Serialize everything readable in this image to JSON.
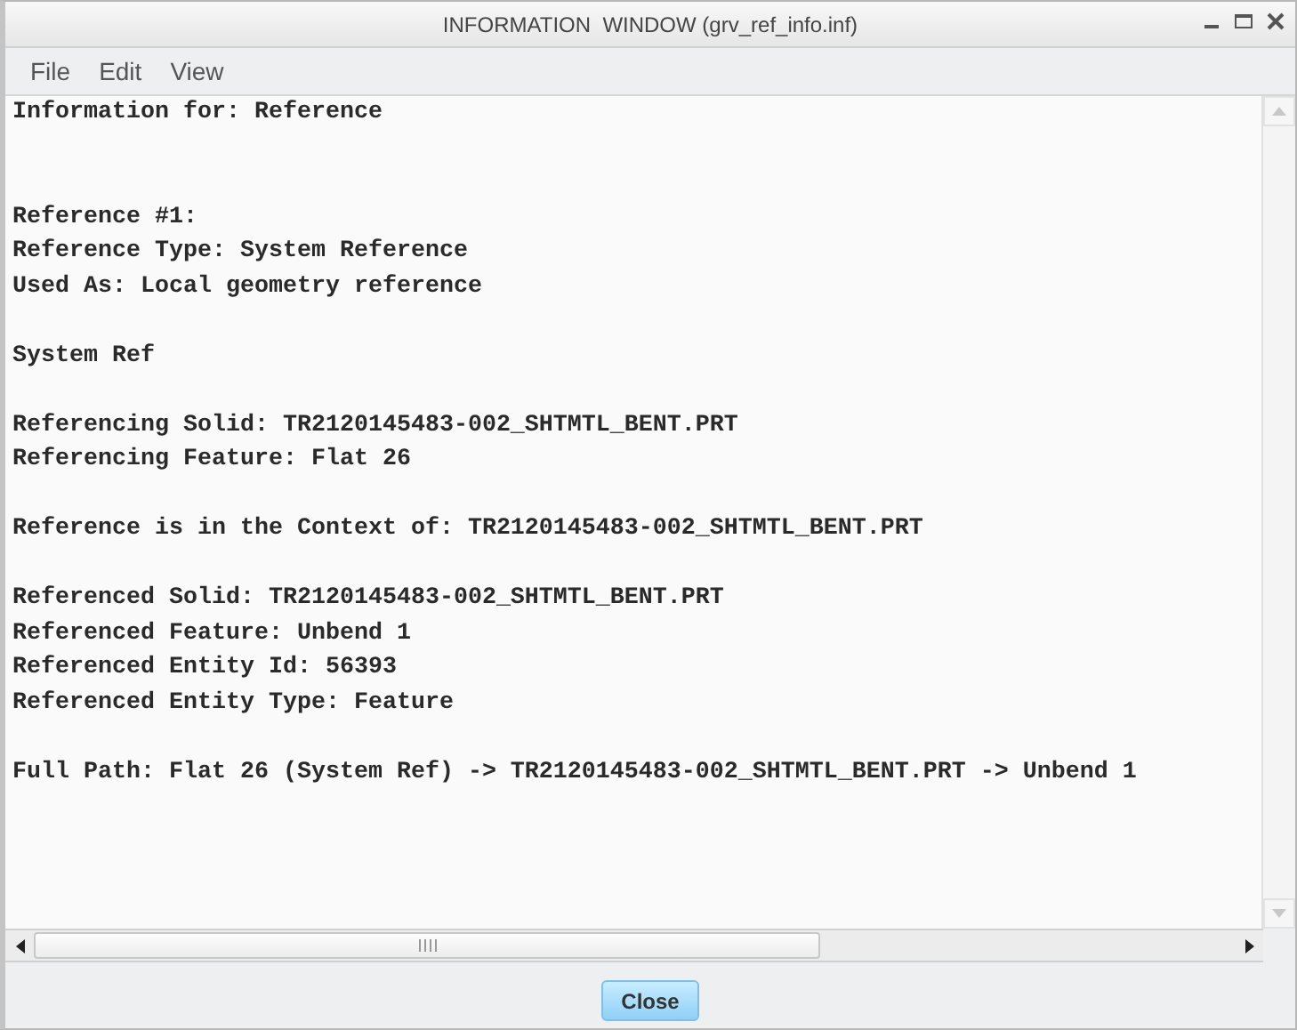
{
  "window": {
    "title": "INFORMATION  WINDOW (grv_ref_info.inf)"
  },
  "menu": [
    {
      "label": "File"
    },
    {
      "label": "Edit"
    },
    {
      "label": "View"
    }
  ],
  "content": [
    {
      "kind": "heading",
      "lines": [
        "Information for: Reference"
      ]
    },
    {
      "kind": "block",
      "lines": [
        "Reference #1:",
        "Reference Type: System Reference",
        "Used As: Local geometry reference"
      ]
    },
    {
      "kind": "block",
      "lines": [
        "System Ref"
      ]
    },
    {
      "kind": "block",
      "lines": [
        "Referencing Solid: TR2120145483-002_SHTMTL_BENT.PRT",
        "Referencing Feature: Flat 26"
      ]
    },
    {
      "kind": "block",
      "lines": [
        "Reference is in the Context of: TR2120145483-002_SHTMTL_BENT.PRT"
      ]
    },
    {
      "kind": "block",
      "lines": [
        "Referenced Solid: TR2120145483-002_SHTMTL_BENT.PRT",
        "Referenced Feature: Unbend 1",
        "Referenced Entity Id: 56393",
        "Referenced Entity Type: Feature"
      ]
    },
    {
      "kind": "block",
      "lines": [
        "Full Path: Flat 26 (System Ref) -> TR2120145483-002_SHTMTL_BENT.PRT -> Unbend 1"
      ]
    }
  ],
  "buttons": [
    {
      "label": "Close"
    }
  ]
}
